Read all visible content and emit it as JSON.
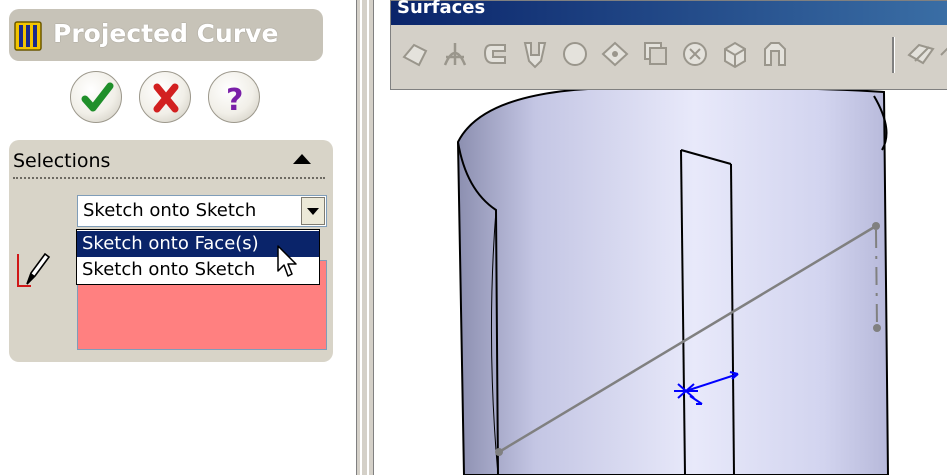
{
  "property_manager": {
    "title": "Projected Curve",
    "ok_icon": "checkmark-icon",
    "cancel_icon": "x-icon",
    "help_icon": "question-icon",
    "selections": {
      "header": "Selections",
      "combo_value": "Sketch onto Sketch",
      "dropdown_options": [
        "Sketch onto Face(s)",
        "Sketch onto Sketch"
      ],
      "highlighted_option": "Sketch onto Face(s)",
      "selection_box_color": "#ff8080"
    }
  },
  "toolbar": {
    "title": "Surfaces",
    "icons": [
      "extruded-surface-icon",
      "revolved-surface-icon",
      "swept-surface-icon",
      "lofted-surface-icon",
      "boundary-surface-icon",
      "planar-surface-icon",
      "offset-surface-icon",
      "ruled-surface-icon",
      "fill-surface-icon",
      "radiate-surface-icon",
      "delete-face-icon",
      "knit-surface-icon"
    ]
  },
  "colors": {
    "selection_highlight": "#0a246a",
    "surface": "#c9cbe8",
    "sketch_line": "#808080",
    "sketch_point_marker": "#0000ff"
  }
}
